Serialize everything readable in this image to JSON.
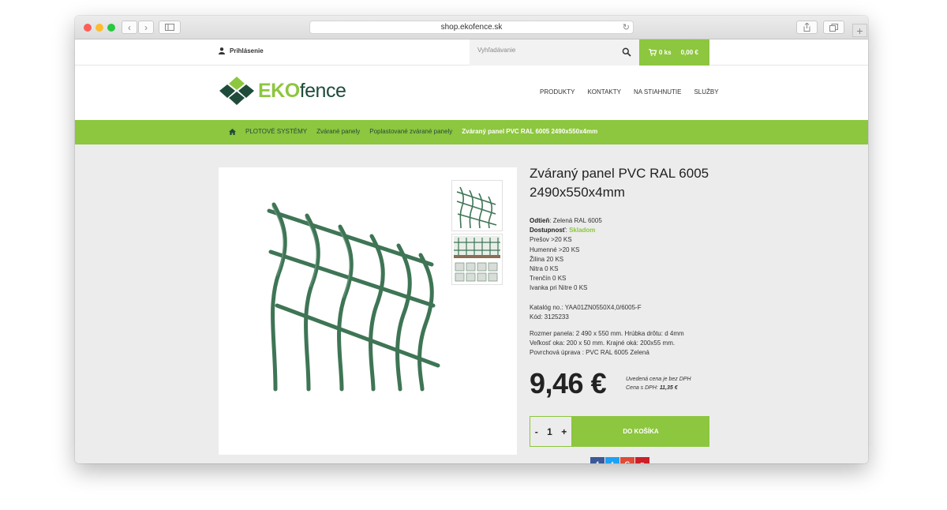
{
  "browser": {
    "url": "shop.ekofence.sk"
  },
  "topbar": {
    "login_label": "Prihlásenie",
    "search_placeholder": "Vyhľadávanie",
    "cart_count": "0 ks",
    "cart_total": "0,00 €"
  },
  "header": {
    "logo": {
      "eko": "EKO",
      "fence": "fence"
    },
    "nav": [
      "PRODUKTY",
      "KONTAKTY",
      "NA STIAHNUTIE",
      "SLUŽBY"
    ]
  },
  "breadcrumb": [
    "PLOTOVÉ SYSTÉMY",
    "Zvárané panely",
    "Poplastované zvárané panely",
    "Zváraný panel PVC RAL 6005 2490x550x4mm"
  ],
  "product": {
    "title": "Zváraný panel PVC RAL 6005 2490x550x4mm",
    "shade_label": "Odtieň",
    "shade_value": "Zelená RAL 6005",
    "availability_label": "Dostupnosť",
    "availability_value": "Skladom",
    "stock": [
      "Prešov >20 KS",
      "Humenné >20 KS",
      "Žilina 20 KS",
      "Nitra 0 KS",
      "Trenčín 0 KS",
      "Ivanka pri Nitre 0 KS"
    ],
    "catalog": "Katalóg no.: YAA01ZN0550X4,0/6005-F",
    "code": "Kód: 3125233",
    "specs": [
      "Rozmer panela: 2 490 x 550 mm. Hrúbka drôtu: d 4mm",
      "Veľkosť oka: 200 x 50 mm. Krajné oká: 200x55 mm.",
      "Povrchová úprava : PVC RAL 6005 Zelená"
    ],
    "price": "9,46 €",
    "vat_note": "Uvedená cena je bez DPH",
    "vat_price_label": "Cena s DPH:",
    "vat_price_value": "11,35 €",
    "qty_minus": "-",
    "qty": "1",
    "qty_plus": "+",
    "add_to_cart": "DO KOŠÍKA"
  },
  "share": {
    "facebook": "f",
    "twitter": "t",
    "google": "G",
    "pinterest": "p"
  },
  "colors": {
    "accent_green": "#8dc63f",
    "logo_dark_green": "#1f4c3a",
    "panel_green": "#3e7555"
  }
}
